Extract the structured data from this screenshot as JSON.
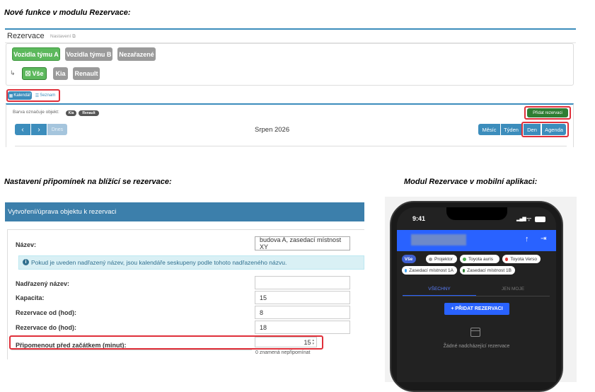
{
  "section1": {
    "heading": "Nové funkce v modulu Rezervace:",
    "title": "Rezervace",
    "settings_link": "Nastavení",
    "filters": [
      "Vozidla týmu A",
      "Vozidla týmu B",
      "Nezařazené"
    ],
    "sub_filters": [
      "Vše",
      "Kia",
      "Renault"
    ],
    "view_tabs": [
      "Kalendář",
      "Seznam"
    ],
    "color_legend_label": "Barva označuje objekt:",
    "color_legend_badges": [
      "Kia",
      "Renault"
    ],
    "add_button": "Přidat rezervaci",
    "today_button": "Dnes",
    "calendar_title": "Srpen 2026",
    "range_buttons": [
      "Měsíc",
      "Týden",
      "Den",
      "Agenda"
    ]
  },
  "section2": {
    "heading": "Nastavení připomínek na blížící se rezervace:",
    "panel_title": "Vytvoření/úprava objektu k rezervaci",
    "name_label": "Název:",
    "name_value": "budova A, zasedací místnost XY",
    "info_text": "Pokud je uveden nadřazený název, jsou kalendáře seskupeny podle tohoto nadřazeného názvu.",
    "parent_label": "Nadřazený název:",
    "parent_value": "",
    "capacity_label": "Kapacita:",
    "capacity_value": "15",
    "from_label": "Rezervace od (hod):",
    "from_value": "8",
    "to_label": "Rezervace do (hod):",
    "to_value": "18",
    "remind_label": "Připomenout před začátkem (minut):",
    "remind_value": "15",
    "remind_hint": "0 znamená nepřipomínat"
  },
  "section3": {
    "heading": "Modul Rezervace v mobilní aplikaci:",
    "time": "9:41",
    "chips": [
      {
        "label": "Vše",
        "color": "#3f5fd0"
      },
      {
        "label": "Projektor",
        "color": "#9e9e9e"
      },
      {
        "label": "Toyota auris",
        "color": "#4caf50"
      },
      {
        "label": "Toyota Verso",
        "color": "#e53935"
      },
      {
        "label": "Zasedací místnost 1A",
        "color": "#42a5f5"
      },
      {
        "label": "Zasedací místnost 1B",
        "color": "#2e7d32"
      }
    ],
    "tabs": [
      "VŠECHNY",
      "JEN MOJE"
    ],
    "add_button": "+ PŘIDAT REZERVACI",
    "empty_text": "Žádné nadcházející rezervace"
  },
  "colors": {
    "green": "#5cb85c",
    "grey": "#9a9a9a",
    "blue": "#3c8dbc",
    "dark_green": "#2e7d32",
    "red_highlight": "#e0303a",
    "mobile_blue": "#2962ff"
  }
}
